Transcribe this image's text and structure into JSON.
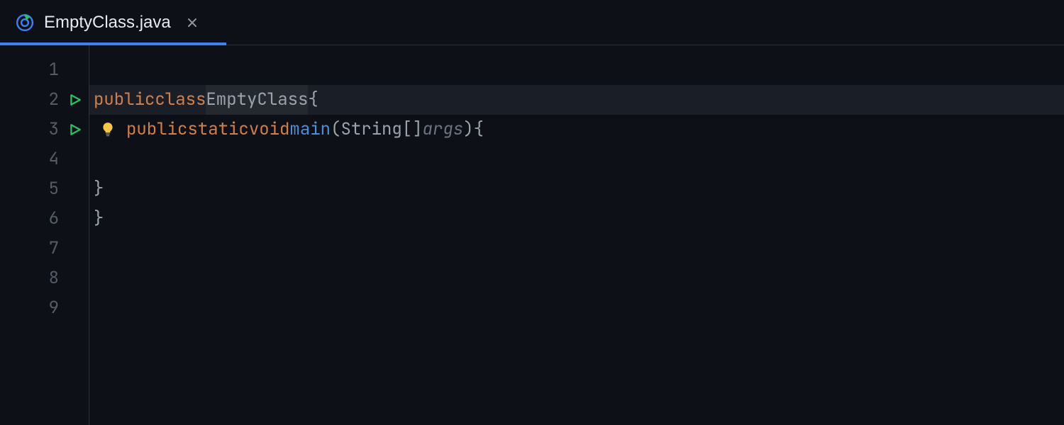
{
  "tab": {
    "title": "EmptyClass.java",
    "active": true
  },
  "gutter": {
    "lines": [
      {
        "num": "1",
        "run": false
      },
      {
        "num": "2",
        "run": true
      },
      {
        "num": "3",
        "run": true
      },
      {
        "num": "4",
        "run": false
      },
      {
        "num": "5",
        "run": false
      },
      {
        "num": "6",
        "run": false
      },
      {
        "num": "7",
        "run": false
      },
      {
        "num": "8",
        "run": false
      },
      {
        "num": "9",
        "run": false
      }
    ]
  },
  "code": {
    "l2": {
      "kw1": "public",
      "kw2": "class",
      "name": "EmptyClass",
      "brace": "{"
    },
    "l3": {
      "kw1": "public",
      "kw2": "static",
      "kw3": "void",
      "func": "main",
      "sig_open": "(",
      "type": "String",
      "brackets": "[]",
      "param": "args",
      "sig_close": ")",
      "brace": "{"
    },
    "l5": {
      "brace": "}"
    },
    "l6": {
      "brace": "}"
    }
  }
}
